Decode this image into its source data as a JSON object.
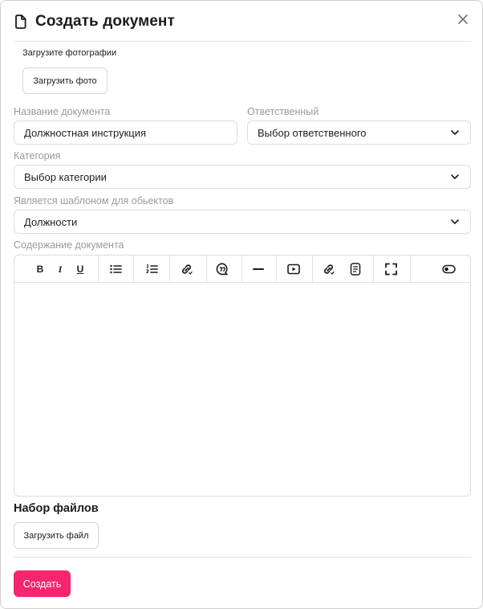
{
  "dialog": {
    "title": "Создать документ",
    "close_icon": "close-icon",
    "doc_icon": "document-icon"
  },
  "photos": {
    "label": "Загрузите фотографии",
    "button": "Загрузить фото"
  },
  "form": {
    "doc_name_label": "Название документа",
    "doc_name_value": "Должностная инструкция",
    "responsible_label": "Ответственный",
    "responsible_value": "Выбор ответственного",
    "category_label": "Категория",
    "category_value": "Выбор категории",
    "template_label": "Является шаблоном для обьектов",
    "template_value": "Должности",
    "content_label": "Содержание документа"
  },
  "toolbar": {
    "items": [
      "bold-icon",
      "italic-icon",
      "underline-icon",
      "bullet-list-icon",
      "numbered-list-icon",
      "link-icon",
      "quote-icon",
      "horizontal-rule-icon",
      "video-icon",
      "link-alt-icon",
      "document-embed-icon",
      "fullscreen-icon",
      "toggle-icon"
    ]
  },
  "files": {
    "title": "Набор файлов",
    "button": "Загрузить файл"
  },
  "footer": {
    "submit": "Создать"
  },
  "colors": {
    "accent": "#f5256f",
    "border": "#dcdcdc",
    "label": "#9a9a9a"
  }
}
